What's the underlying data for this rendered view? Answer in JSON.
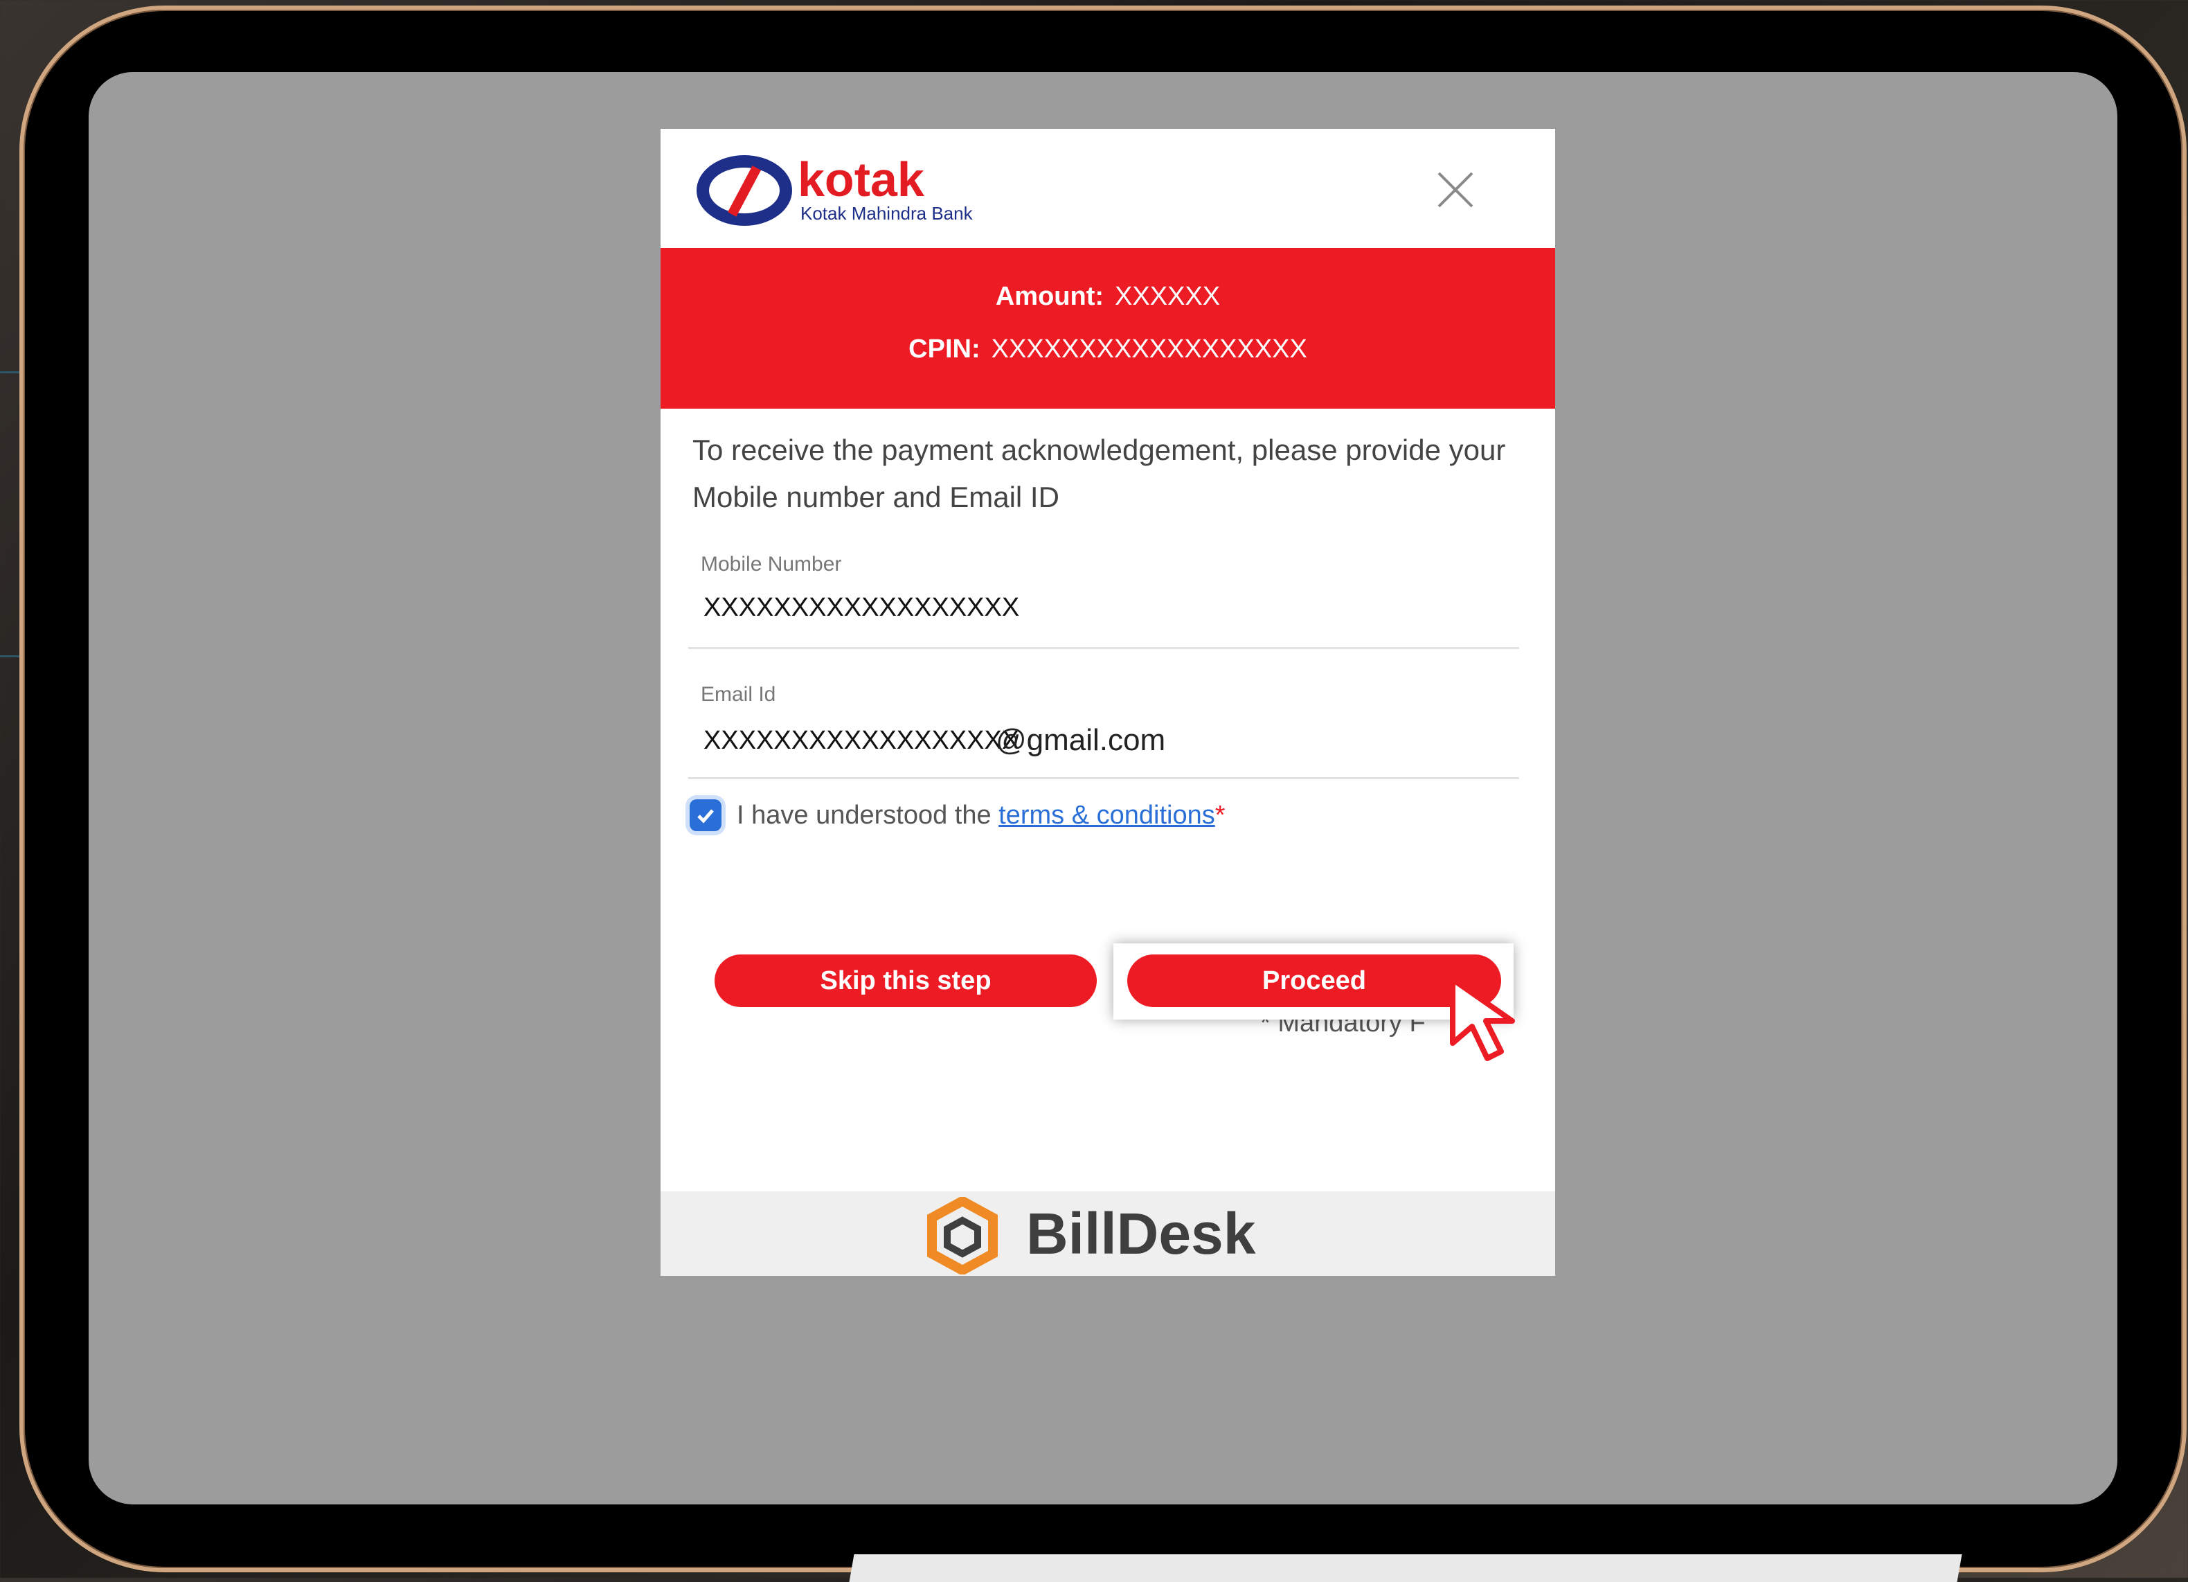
{
  "modal": {
    "logo": {
      "brand": "kotak",
      "subtitle": "Kotak Mahindra Bank"
    },
    "banner": {
      "amount_label": "Amount:",
      "amount_value": "XXXXXX",
      "cpin_label": "CPIN:",
      "cpin_value": "XXXXXXXXXXXXXXXXXX"
    },
    "intro_text": "To receive the payment acknowledgement, please provide your Mobile number and Email ID",
    "mobile": {
      "label": "Mobile Number",
      "value": "XXXXXXXXXXXXXXXXXX"
    },
    "email": {
      "label": "Email Id",
      "value": "XXXXXXXXXXXXXXXXXX",
      "domain": "@gmail.com"
    },
    "terms": {
      "checked": true,
      "prefix": "I have understood the",
      "link_text": "terms & conditions",
      "required_mark": "*"
    },
    "buttons": {
      "skip": "Skip this step",
      "proceed": "Proceed"
    },
    "mandatory_note": "* Mandatory F",
    "footer_brand": "BillDesk"
  },
  "colors": {
    "accent_red": "#ed1c24",
    "kotak_blue": "#1e2f8a",
    "link_blue": "#2a6fd8",
    "billdesk_orange": "#f08a24"
  },
  "icons": [
    "close-icon",
    "checkbox-check-icon",
    "pointer-cursor-icon",
    "billdesk-hexagon-icon"
  ]
}
